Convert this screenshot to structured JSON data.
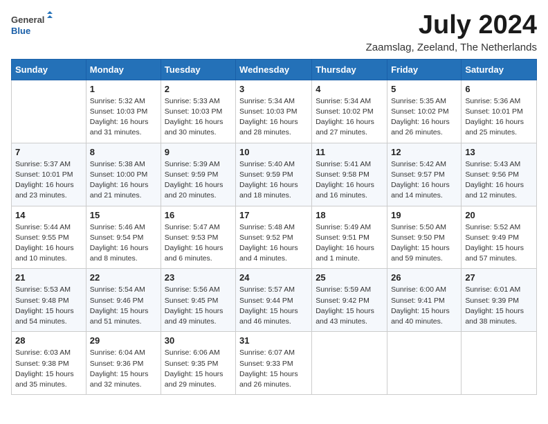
{
  "logo": {
    "general": "General",
    "blue": "Blue"
  },
  "title": "July 2024",
  "subtitle": "Zaamslag, Zeeland, The Netherlands",
  "headers": [
    "Sunday",
    "Monday",
    "Tuesday",
    "Wednesday",
    "Thursday",
    "Friday",
    "Saturday"
  ],
  "weeks": [
    [
      null,
      {
        "date": "1",
        "sunrise": "5:32 AM",
        "sunset": "10:03 PM",
        "daylight": "16 hours and 31 minutes."
      },
      {
        "date": "2",
        "sunrise": "5:33 AM",
        "sunset": "10:03 PM",
        "daylight": "16 hours and 30 minutes."
      },
      {
        "date": "3",
        "sunrise": "5:34 AM",
        "sunset": "10:03 PM",
        "daylight": "16 hours and 28 minutes."
      },
      {
        "date": "4",
        "sunrise": "5:34 AM",
        "sunset": "10:02 PM",
        "daylight": "16 hours and 27 minutes."
      },
      {
        "date": "5",
        "sunrise": "5:35 AM",
        "sunset": "10:02 PM",
        "daylight": "16 hours and 26 minutes."
      },
      {
        "date": "6",
        "sunrise": "5:36 AM",
        "sunset": "10:01 PM",
        "daylight": "16 hours and 25 minutes."
      }
    ],
    [
      {
        "date": "7",
        "sunrise": "5:37 AM",
        "sunset": "10:01 PM",
        "daylight": "16 hours and 23 minutes."
      },
      {
        "date": "8",
        "sunrise": "5:38 AM",
        "sunset": "10:00 PM",
        "daylight": "16 hours and 21 minutes."
      },
      {
        "date": "9",
        "sunrise": "5:39 AM",
        "sunset": "9:59 PM",
        "daylight": "16 hours and 20 minutes."
      },
      {
        "date": "10",
        "sunrise": "5:40 AM",
        "sunset": "9:59 PM",
        "daylight": "16 hours and 18 minutes."
      },
      {
        "date": "11",
        "sunrise": "5:41 AM",
        "sunset": "9:58 PM",
        "daylight": "16 hours and 16 minutes."
      },
      {
        "date": "12",
        "sunrise": "5:42 AM",
        "sunset": "9:57 PM",
        "daylight": "16 hours and 14 minutes."
      },
      {
        "date": "13",
        "sunrise": "5:43 AM",
        "sunset": "9:56 PM",
        "daylight": "16 hours and 12 minutes."
      }
    ],
    [
      {
        "date": "14",
        "sunrise": "5:44 AM",
        "sunset": "9:55 PM",
        "daylight": "16 hours and 10 minutes."
      },
      {
        "date": "15",
        "sunrise": "5:46 AM",
        "sunset": "9:54 PM",
        "daylight": "16 hours and 8 minutes."
      },
      {
        "date": "16",
        "sunrise": "5:47 AM",
        "sunset": "9:53 PM",
        "daylight": "16 hours and 6 minutes."
      },
      {
        "date": "17",
        "sunrise": "5:48 AM",
        "sunset": "9:52 PM",
        "daylight": "16 hours and 4 minutes."
      },
      {
        "date": "18",
        "sunrise": "5:49 AM",
        "sunset": "9:51 PM",
        "daylight": "16 hours and 1 minute."
      },
      {
        "date": "19",
        "sunrise": "5:50 AM",
        "sunset": "9:50 PM",
        "daylight": "15 hours and 59 minutes."
      },
      {
        "date": "20",
        "sunrise": "5:52 AM",
        "sunset": "9:49 PM",
        "daylight": "15 hours and 57 minutes."
      }
    ],
    [
      {
        "date": "21",
        "sunrise": "5:53 AM",
        "sunset": "9:48 PM",
        "daylight": "15 hours and 54 minutes."
      },
      {
        "date": "22",
        "sunrise": "5:54 AM",
        "sunset": "9:46 PM",
        "daylight": "15 hours and 51 minutes."
      },
      {
        "date": "23",
        "sunrise": "5:56 AM",
        "sunset": "9:45 PM",
        "daylight": "15 hours and 49 minutes."
      },
      {
        "date": "24",
        "sunrise": "5:57 AM",
        "sunset": "9:44 PM",
        "daylight": "15 hours and 46 minutes."
      },
      {
        "date": "25",
        "sunrise": "5:59 AM",
        "sunset": "9:42 PM",
        "daylight": "15 hours and 43 minutes."
      },
      {
        "date": "26",
        "sunrise": "6:00 AM",
        "sunset": "9:41 PM",
        "daylight": "15 hours and 40 minutes."
      },
      {
        "date": "27",
        "sunrise": "6:01 AM",
        "sunset": "9:39 PM",
        "daylight": "15 hours and 38 minutes."
      }
    ],
    [
      {
        "date": "28",
        "sunrise": "6:03 AM",
        "sunset": "9:38 PM",
        "daylight": "15 hours and 35 minutes."
      },
      {
        "date": "29",
        "sunrise": "6:04 AM",
        "sunset": "9:36 PM",
        "daylight": "15 hours and 32 minutes."
      },
      {
        "date": "30",
        "sunrise": "6:06 AM",
        "sunset": "9:35 PM",
        "daylight": "15 hours and 29 minutes."
      },
      {
        "date": "31",
        "sunrise": "6:07 AM",
        "sunset": "9:33 PM",
        "daylight": "15 hours and 26 minutes."
      },
      null,
      null,
      null
    ]
  ],
  "labels": {
    "sunrise": "Sunrise:",
    "sunset": "Sunset:",
    "daylight": "Daylight:"
  }
}
